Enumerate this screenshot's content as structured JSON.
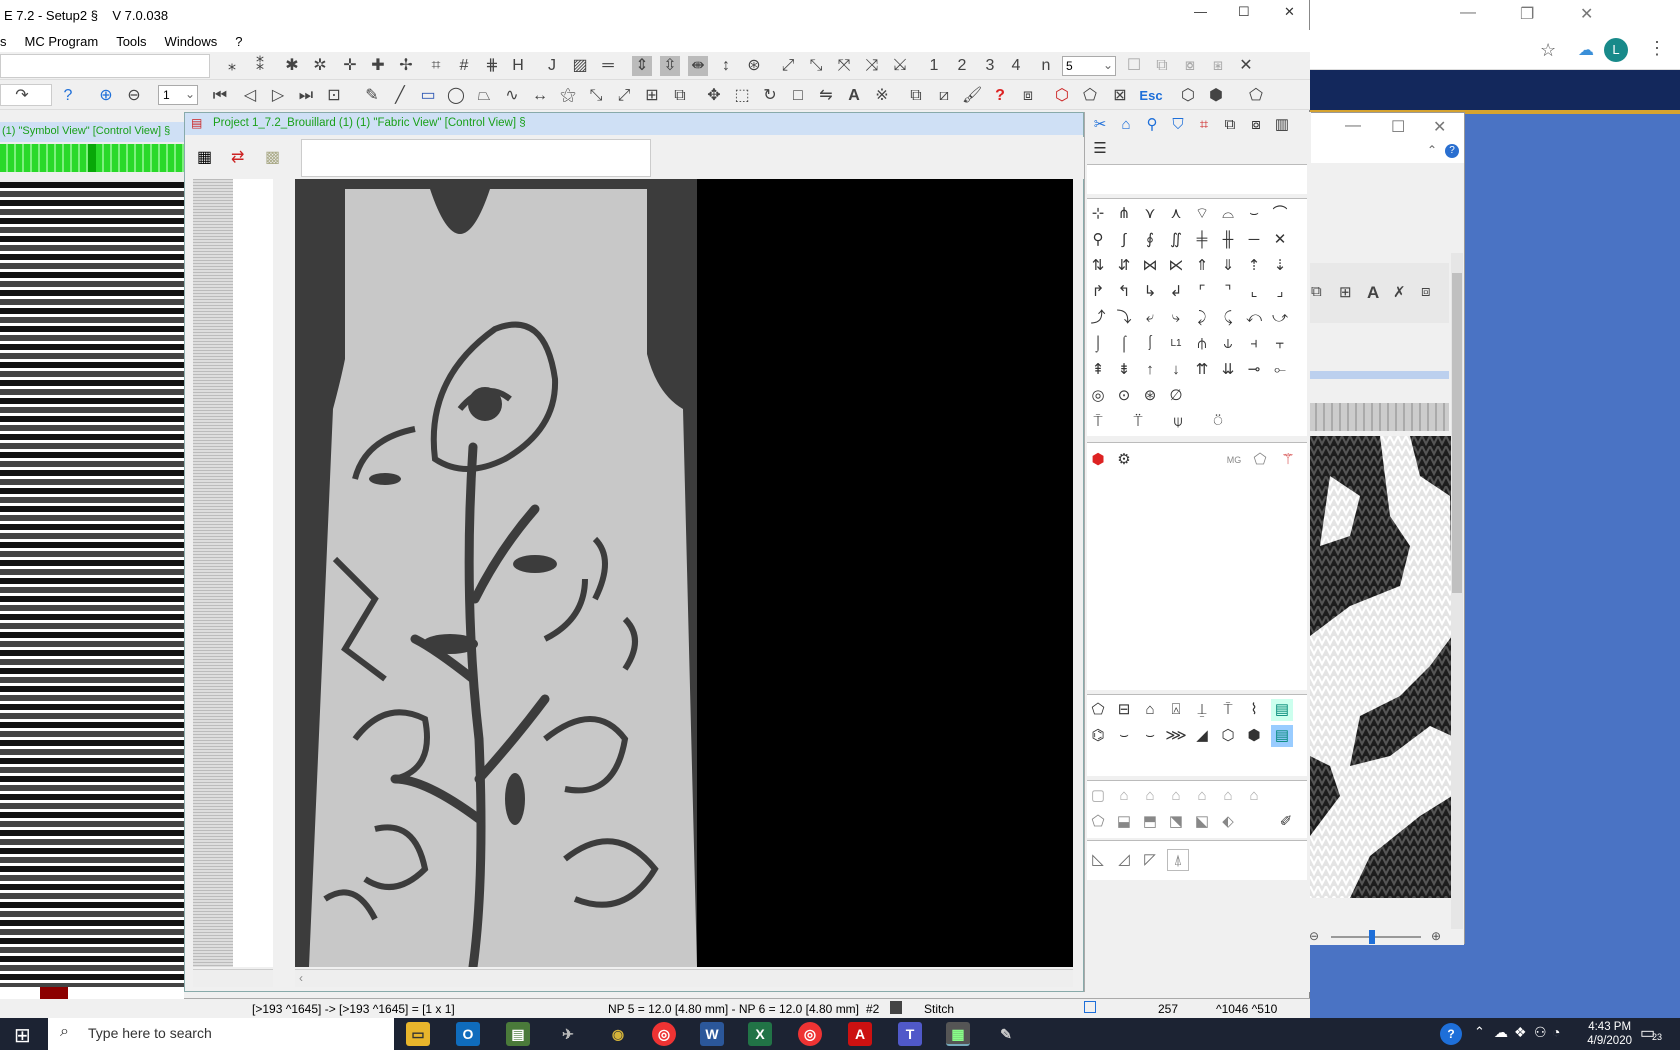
{
  "app": {
    "title": "E 7.2 - Setup2 §    V 7.0.038",
    "menus": [
      "s",
      "MC Program",
      "Tools",
      "Windows",
      "?"
    ],
    "zoom_select": "1",
    "number_buttons": [
      "1",
      "2",
      "3",
      "4",
      "n"
    ],
    "number_select": "5",
    "esc_label": "Esc"
  },
  "symbol_view": {
    "title": "(1) \"Symbol View\" [Control View] §"
  },
  "fabric_view": {
    "title": "Project 1_7.2_Brouillard (1) (1) \"Fabric View\" [Control View] §"
  },
  "tools": {
    "mg_label": "MG",
    "l1_label": "L1"
  },
  "status": {
    "position": "[>193 ^1645] -> [>193 ^1645] = [1 x 1]",
    "needles": "NP 5 = 12.0 [4.80 mm] - NP 6 = 12.0 [4.80 mm]",
    "color_no": "#2",
    "mode": "Stitch",
    "value": "257",
    "coords": "^1046  ^510"
  },
  "browser": {
    "avatar": "L",
    "help": "?"
  },
  "taskbar": {
    "search_placeholder": "Type here to search",
    "time": "4:43 PM",
    "date": "4/9/2020",
    "notifications": "23"
  },
  "colors": {
    "title_green": "#1aa01a",
    "garment_gray": "#c8c8c8",
    "motif_dark": "#3c3c3c",
    "taskbar": "#1c2333"
  }
}
